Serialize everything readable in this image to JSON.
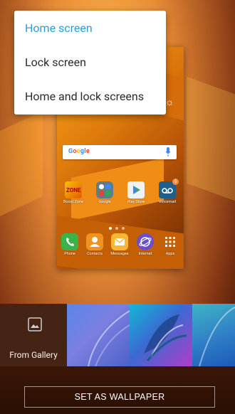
{
  "menu": {
    "items": [
      {
        "label": "Home screen",
        "active": true
      },
      {
        "label": "Lock screen",
        "active": false
      },
      {
        "label": "Home and lock screens",
        "active": false
      }
    ]
  },
  "preview": {
    "search_logo": "Google",
    "apps_row1": [
      {
        "label": "Boost Zone",
        "icon": "boost-zone-icon"
      },
      {
        "label": "Google",
        "icon": "google-folder-icon"
      },
      {
        "label": "Play Store",
        "icon": "play-store-icon"
      },
      {
        "label": "Voicemail",
        "icon": "voicemail-icon",
        "badge": "5"
      }
    ],
    "dock": [
      {
        "label": "Phone",
        "icon": "phone-icon"
      },
      {
        "label": "Contacts",
        "icon": "contacts-icon"
      },
      {
        "label": "Messages",
        "icon": "messages-icon"
      },
      {
        "label": "Internet",
        "icon": "internet-icon"
      },
      {
        "label": "Apps",
        "icon": "apps-icon"
      }
    ]
  },
  "strip": {
    "gallery_label": "From Gallery"
  },
  "action": {
    "set_wallpaper": "SET AS WALLPAPER"
  }
}
